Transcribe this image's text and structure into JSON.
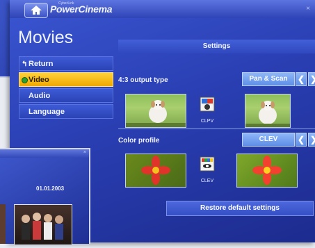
{
  "app": {
    "brand": "PowerCinema",
    "brand_small": "CyberLink"
  },
  "page": {
    "title": "Movies"
  },
  "nav": {
    "items": [
      {
        "label": "Return",
        "icon": "return-arrow-icon"
      },
      {
        "label": "Video",
        "icon": "green-bullet-icon",
        "selected": true
      },
      {
        "label": "Audio"
      },
      {
        "label": "Language"
      }
    ]
  },
  "settings": {
    "header": "Settings",
    "output_type": {
      "label": "4:3 output type",
      "value": "Pan & Scan",
      "clpv_label": "CLPV"
    },
    "color_profile": {
      "label": "Color profile",
      "value": "CLEV",
      "clev_label": "CLEV"
    },
    "restore_label": "Restore default settings"
  },
  "front_window": {
    "date": "01.01.2003"
  },
  "colors": {
    "accent_yellow": "#f5b800",
    "panel_blue": "#2a3fb3",
    "button_light": "#6e9cf0"
  }
}
